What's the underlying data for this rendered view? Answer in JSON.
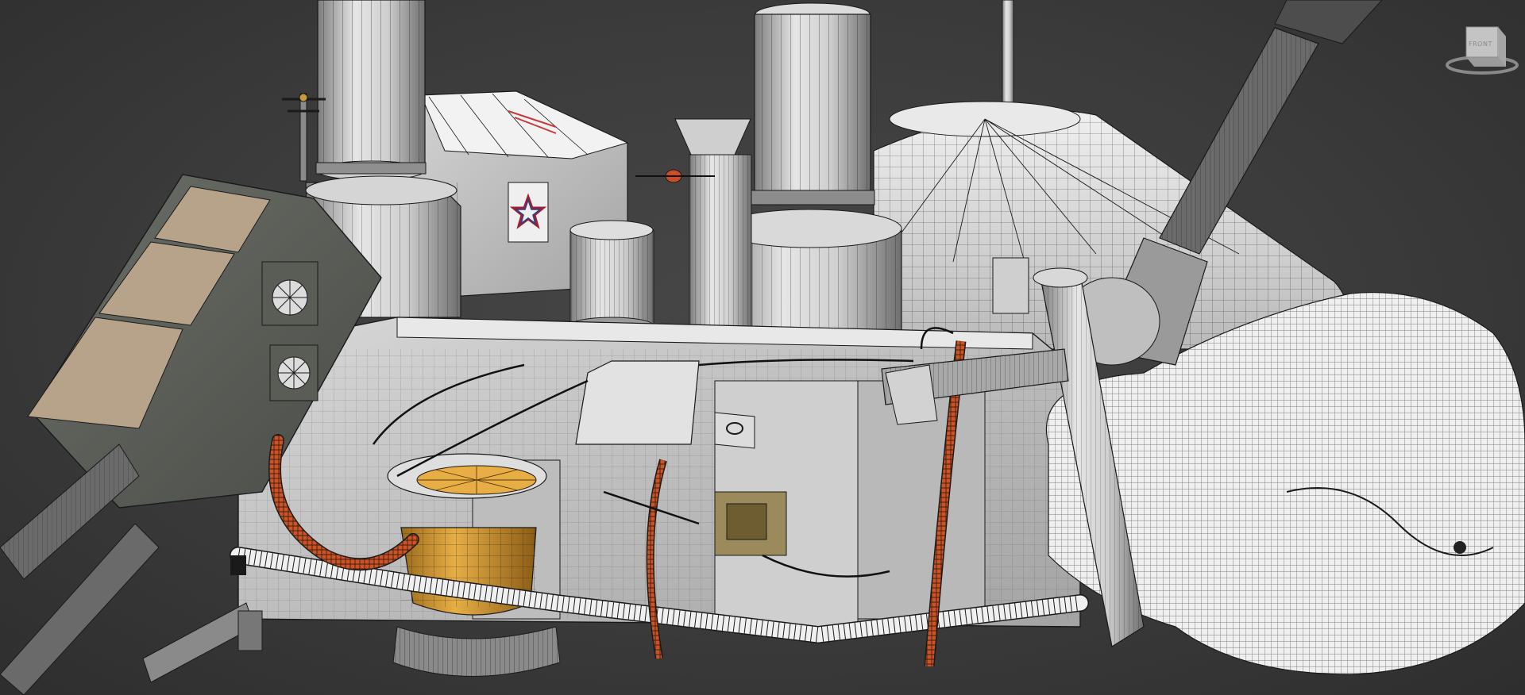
{
  "viewport": {
    "background": "#3d3d3d",
    "wire_color": "#1a1a1a",
    "shade_color": "#cfcfcf",
    "accent_orange": "#d99a2b",
    "cable_orange": "#c8552a"
  },
  "viewcube": {
    "icon": "view-cube-icon",
    "face_label": "FRONT"
  }
}
